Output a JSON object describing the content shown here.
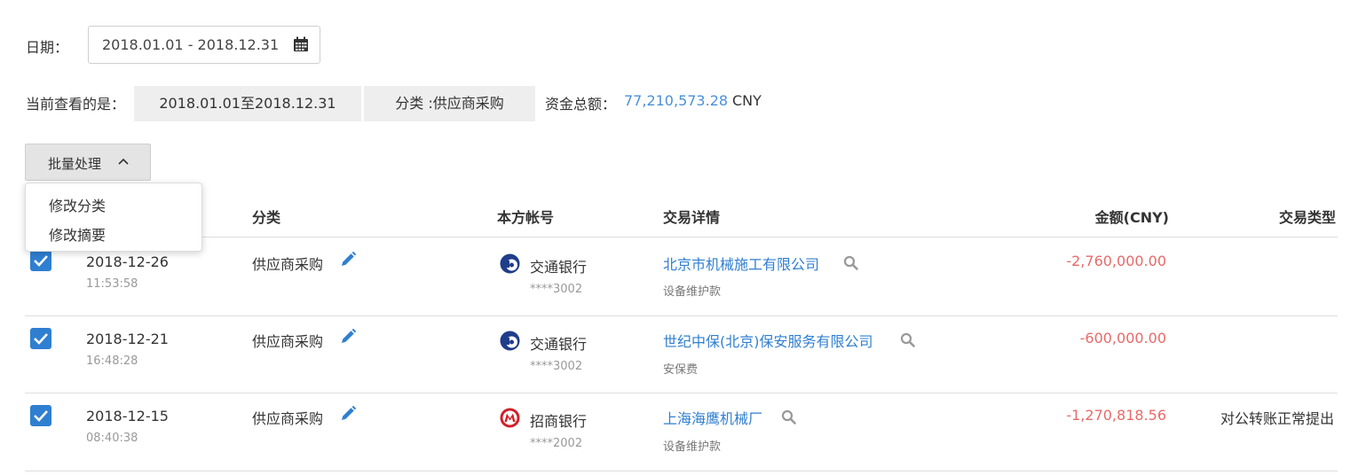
{
  "filters": {
    "date_label": "日期：",
    "date_range_value": "2018.01.01 - 2018.12.31"
  },
  "summary": {
    "viewing_label": "当前查看的是：",
    "range_chip": "2018.01.01至2018.12.31",
    "category_chip": "分类 :供应商采购",
    "total_label": "资金总额：",
    "total_amount": "77,210,573.28",
    "currency": "CNY"
  },
  "batch": {
    "button_label": "批量处理",
    "menu": [
      "修改分类",
      "修改摘要"
    ]
  },
  "table": {
    "headers": {
      "category": "分类",
      "account": "本方帐号",
      "details": "交易详情",
      "amount": "金额(CNY)",
      "type": "交易类型"
    },
    "rows": [
      {
        "date": "2018-12-26",
        "time": "11:53:58",
        "category": "供应商采购",
        "bank": "交通银行",
        "bank_icon": "bocom-logo-icon",
        "account": "****3002",
        "counterparty": "北京市机械施工有限公司",
        "memo": "设备维护款",
        "amount": "-2,760,000.00",
        "type": ""
      },
      {
        "date": "2018-12-21",
        "time": "16:48:28",
        "category": "供应商采购",
        "bank": "交通银行",
        "bank_icon": "bocom-logo-icon",
        "account": "****3002",
        "counterparty": "世纪中保(北京)保安服务有限公司",
        "memo": "安保费",
        "amount": "-600,000.00",
        "type": ""
      },
      {
        "date": "2018-12-15",
        "time": "08:40:38",
        "category": "供应商采购",
        "bank": "招商银行",
        "bank_icon": "cmb-logo-icon",
        "account": "****2002",
        "counterparty": "上海海鹰机械厂",
        "memo": "设备维护款",
        "amount": "-1,270,818.56",
        "type": "对公转账正常提出"
      }
    ]
  },
  "colors": {
    "link": "#2f7fd1",
    "total_amount": "#4a90d9",
    "negative_amount": "#e86a6a",
    "checkbox": "#2f7fd1",
    "chip_bg": "#eeeeee"
  }
}
